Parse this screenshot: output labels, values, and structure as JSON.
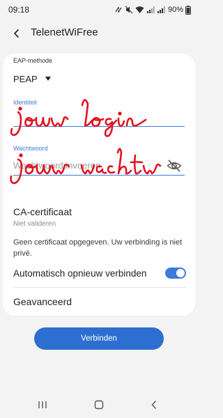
{
  "status_bar": {
    "time": "09:18",
    "battery": "90%"
  },
  "app_bar": {
    "title": "TelenetWiFree"
  },
  "form": {
    "eap_method_label": "EAP-methode",
    "eap_method_value": "PEAP",
    "identity_label": "Identiteit",
    "identity_value": "",
    "password_label": "Wachtwoord",
    "password_placeholder": "Wachtwoord invoeren",
    "handwritten_identity": "jouw login",
    "handwritten_password": "jouw wachtw",
    "ca_certificate_title": "CA-certificaat",
    "ca_certificate_value": "Niet valideren",
    "certificate_warning": "Geen certificaat opgegeven. Uw verbinding is niet privé.",
    "auto_reconnect_label": "Automatisch opnieuw verbinden",
    "auto_reconnect_enabled": true,
    "advanced_label": "Geavanceerd"
  },
  "actions": {
    "connect_label": "Verbinden"
  },
  "colors": {
    "accent": "#3e7bd6",
    "button": "#2d6fd0",
    "handwriting": "#e0131f",
    "background": "#f3f3f3",
    "card": "#ffffff"
  },
  "icons": {
    "back": "arrow-left-icon",
    "dropdown": "triangle-down-icon",
    "password_visibility": "eye-off-icon",
    "nav_recents": "recents-icon",
    "nav_home": "home-icon",
    "nav_back": "chevron-left-icon"
  }
}
